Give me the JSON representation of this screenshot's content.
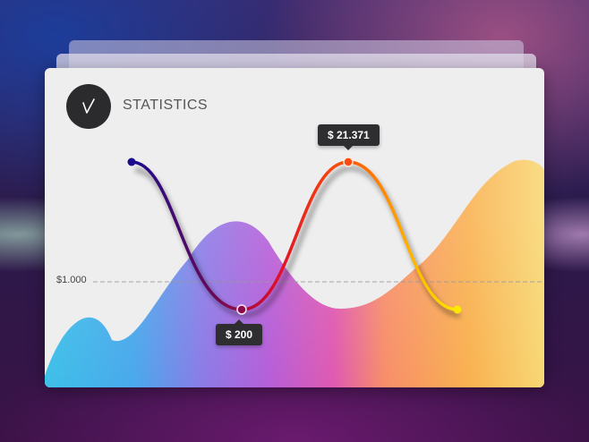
{
  "header": {
    "title": "STATISTICS",
    "logo_icon": "check-v-icon"
  },
  "axis": {
    "reference_label": "$1.000"
  },
  "tooltips": {
    "max": "$ 21.371",
    "min": "$ 200"
  },
  "colors": {
    "logo_bg": "#2b2b2d",
    "line_start": "#1a0b8c",
    "line_mid": "#ff1a00",
    "line_end": "#ffe800"
  }
}
